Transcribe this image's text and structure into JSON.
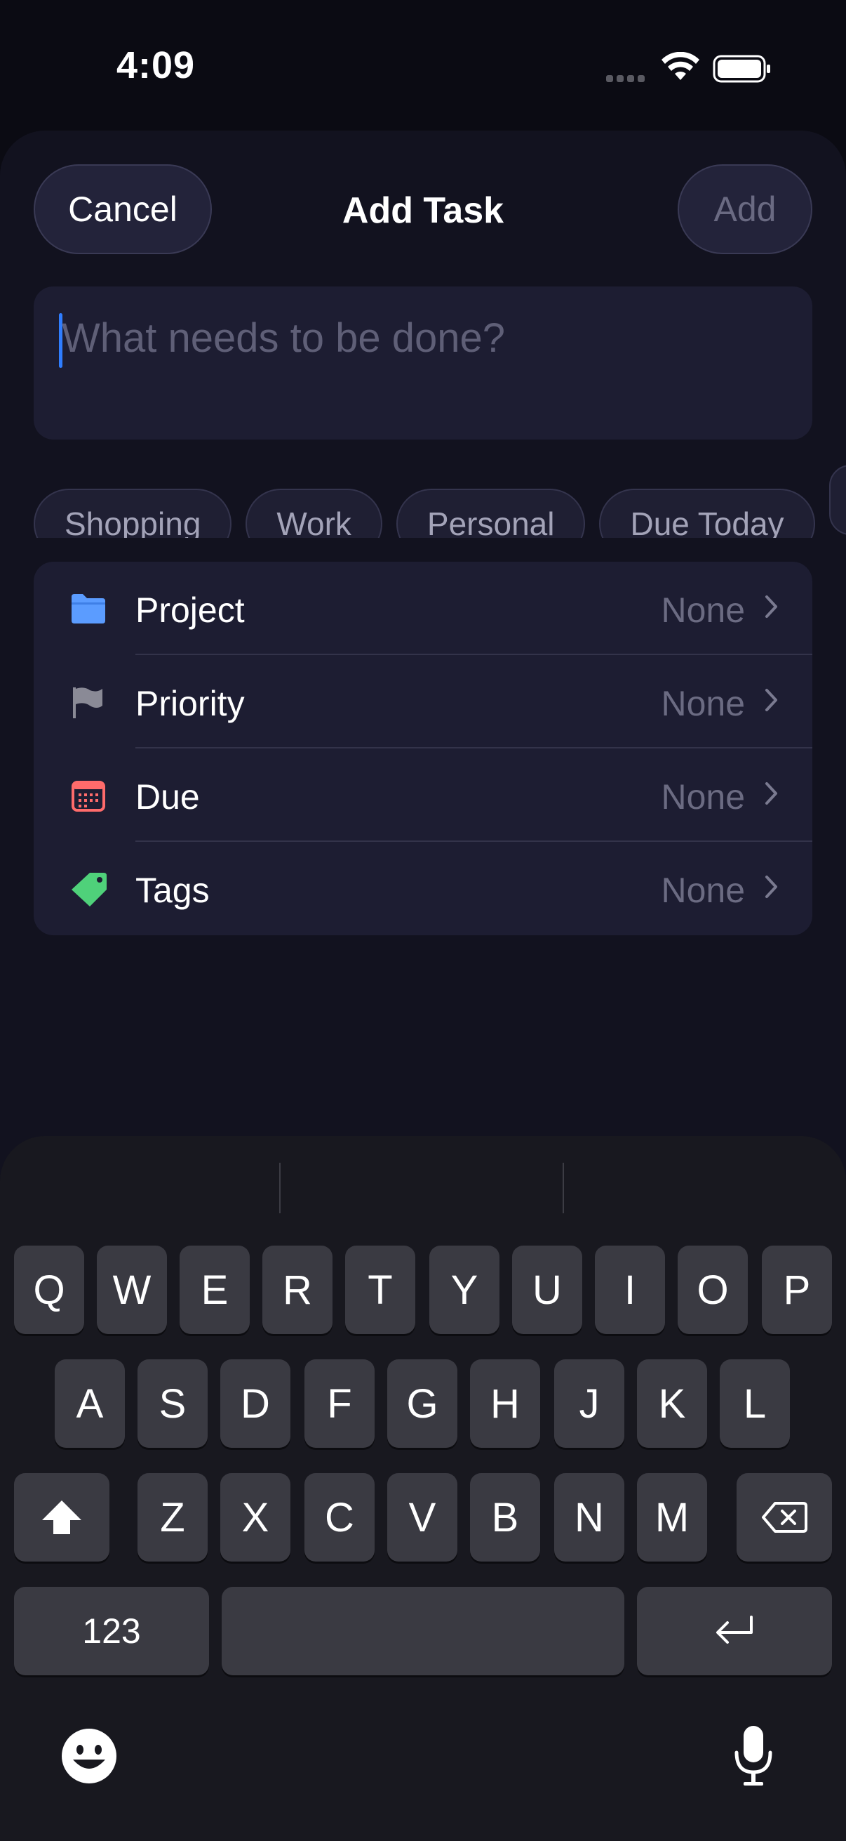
{
  "status": {
    "time": "4:09"
  },
  "header": {
    "cancel_label": "Cancel",
    "title": "Add Task",
    "add_label": "Add"
  },
  "task": {
    "placeholder": "What needs to be done?"
  },
  "quick_chips": [
    "Shopping",
    "Work",
    "Personal",
    "Due Today"
  ],
  "options": [
    {
      "label": "Project",
      "value": "None",
      "icon": "folder-icon",
      "color": "#5b9cff"
    },
    {
      "label": "Priority",
      "value": "None",
      "icon": "flag-icon",
      "color": "#8a8a96"
    },
    {
      "label": "Due",
      "value": "None",
      "icon": "calendar-icon",
      "color": "#ff6b6b"
    },
    {
      "label": "Tags",
      "value": "None",
      "icon": "tag-icon",
      "color": "#4fd17a"
    }
  ],
  "keyboard": {
    "row1": [
      "Q",
      "W",
      "E",
      "R",
      "T",
      "Y",
      "U",
      "I",
      "O",
      "P"
    ],
    "row2": [
      "A",
      "S",
      "D",
      "F",
      "G",
      "H",
      "J",
      "K",
      "L"
    ],
    "row3": [
      "Z",
      "X",
      "C",
      "V",
      "B",
      "N",
      "M"
    ],
    "numbers_label": "123"
  }
}
